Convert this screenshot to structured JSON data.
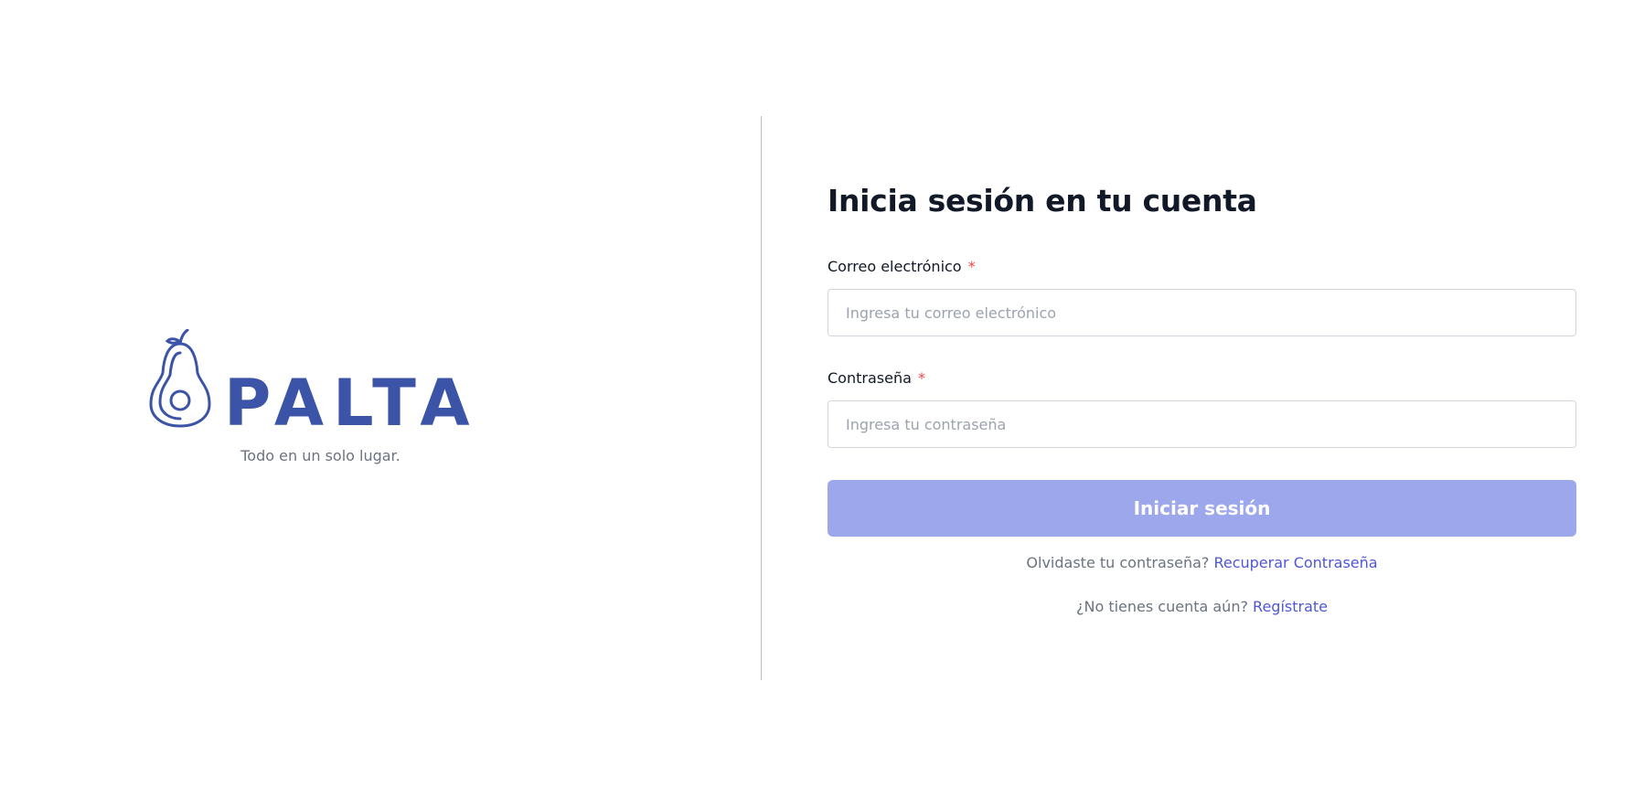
{
  "brand": {
    "logo_text": "PALTA",
    "tagline": "Todo en un solo lugar.",
    "logo_color": "#3c54a8"
  },
  "login": {
    "title": "Inicia sesión en tu cuenta",
    "email": {
      "label": "Correo electrónico",
      "required_mark": "*",
      "placeholder": "Ingresa tu correo electrónico",
      "value": ""
    },
    "password": {
      "label": "Contraseña",
      "required_mark": "*",
      "placeholder": "Ingresa tu contraseña",
      "value": ""
    },
    "submit_label": "Iniciar sesión",
    "forgot_prompt": "Olvidaste tu contraseña?",
    "forgot_link": "Recuperar Contraseña",
    "register_prompt": "¿No tienes cuenta aún?",
    "register_link": "Regístrate"
  },
  "colors": {
    "primary_button": "#9da7ec",
    "link": "#4f56d6",
    "required": "#ef4444",
    "divider": "#bdbdbd"
  },
  "icons": {
    "logo_icon": "avocado-icon"
  }
}
